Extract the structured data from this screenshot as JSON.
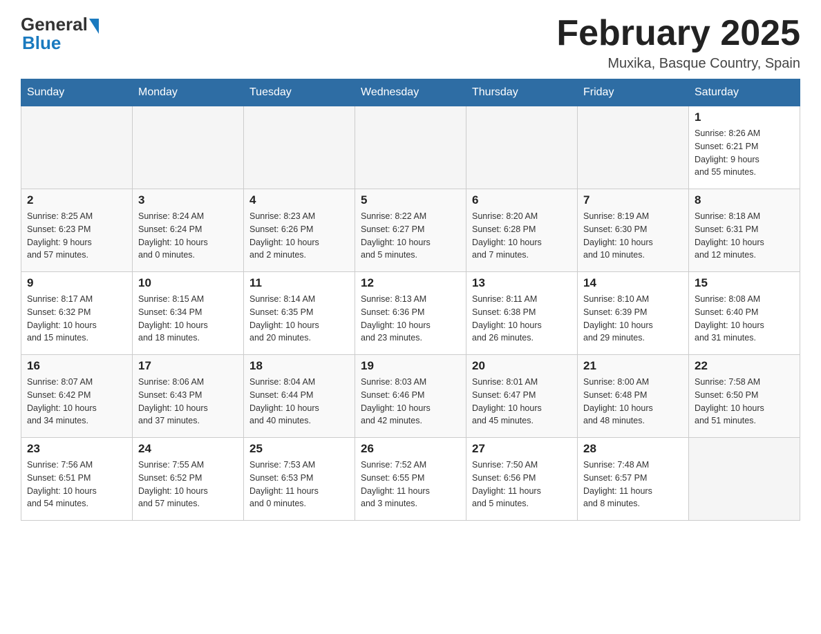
{
  "header": {
    "logo_general": "General",
    "logo_blue": "Blue",
    "month_title": "February 2025",
    "location": "Muxika, Basque Country, Spain"
  },
  "days_of_week": [
    "Sunday",
    "Monday",
    "Tuesday",
    "Wednesday",
    "Thursday",
    "Friday",
    "Saturday"
  ],
  "weeks": [
    {
      "days": [
        {
          "number": "",
          "info": ""
        },
        {
          "number": "",
          "info": ""
        },
        {
          "number": "",
          "info": ""
        },
        {
          "number": "",
          "info": ""
        },
        {
          "number": "",
          "info": ""
        },
        {
          "number": "",
          "info": ""
        },
        {
          "number": "1",
          "info": "Sunrise: 8:26 AM\nSunset: 6:21 PM\nDaylight: 9 hours\nand 55 minutes."
        }
      ]
    },
    {
      "days": [
        {
          "number": "2",
          "info": "Sunrise: 8:25 AM\nSunset: 6:23 PM\nDaylight: 9 hours\nand 57 minutes."
        },
        {
          "number": "3",
          "info": "Sunrise: 8:24 AM\nSunset: 6:24 PM\nDaylight: 10 hours\nand 0 minutes."
        },
        {
          "number": "4",
          "info": "Sunrise: 8:23 AM\nSunset: 6:26 PM\nDaylight: 10 hours\nand 2 minutes."
        },
        {
          "number": "5",
          "info": "Sunrise: 8:22 AM\nSunset: 6:27 PM\nDaylight: 10 hours\nand 5 minutes."
        },
        {
          "number": "6",
          "info": "Sunrise: 8:20 AM\nSunset: 6:28 PM\nDaylight: 10 hours\nand 7 minutes."
        },
        {
          "number": "7",
          "info": "Sunrise: 8:19 AM\nSunset: 6:30 PM\nDaylight: 10 hours\nand 10 minutes."
        },
        {
          "number": "8",
          "info": "Sunrise: 8:18 AM\nSunset: 6:31 PM\nDaylight: 10 hours\nand 12 minutes."
        }
      ]
    },
    {
      "days": [
        {
          "number": "9",
          "info": "Sunrise: 8:17 AM\nSunset: 6:32 PM\nDaylight: 10 hours\nand 15 minutes."
        },
        {
          "number": "10",
          "info": "Sunrise: 8:15 AM\nSunset: 6:34 PM\nDaylight: 10 hours\nand 18 minutes."
        },
        {
          "number": "11",
          "info": "Sunrise: 8:14 AM\nSunset: 6:35 PM\nDaylight: 10 hours\nand 20 minutes."
        },
        {
          "number": "12",
          "info": "Sunrise: 8:13 AM\nSunset: 6:36 PM\nDaylight: 10 hours\nand 23 minutes."
        },
        {
          "number": "13",
          "info": "Sunrise: 8:11 AM\nSunset: 6:38 PM\nDaylight: 10 hours\nand 26 minutes."
        },
        {
          "number": "14",
          "info": "Sunrise: 8:10 AM\nSunset: 6:39 PM\nDaylight: 10 hours\nand 29 minutes."
        },
        {
          "number": "15",
          "info": "Sunrise: 8:08 AM\nSunset: 6:40 PM\nDaylight: 10 hours\nand 31 minutes."
        }
      ]
    },
    {
      "days": [
        {
          "number": "16",
          "info": "Sunrise: 8:07 AM\nSunset: 6:42 PM\nDaylight: 10 hours\nand 34 minutes."
        },
        {
          "number": "17",
          "info": "Sunrise: 8:06 AM\nSunset: 6:43 PM\nDaylight: 10 hours\nand 37 minutes."
        },
        {
          "number": "18",
          "info": "Sunrise: 8:04 AM\nSunset: 6:44 PM\nDaylight: 10 hours\nand 40 minutes."
        },
        {
          "number": "19",
          "info": "Sunrise: 8:03 AM\nSunset: 6:46 PM\nDaylight: 10 hours\nand 42 minutes."
        },
        {
          "number": "20",
          "info": "Sunrise: 8:01 AM\nSunset: 6:47 PM\nDaylight: 10 hours\nand 45 minutes."
        },
        {
          "number": "21",
          "info": "Sunrise: 8:00 AM\nSunset: 6:48 PM\nDaylight: 10 hours\nand 48 minutes."
        },
        {
          "number": "22",
          "info": "Sunrise: 7:58 AM\nSunset: 6:50 PM\nDaylight: 10 hours\nand 51 minutes."
        }
      ]
    },
    {
      "days": [
        {
          "number": "23",
          "info": "Sunrise: 7:56 AM\nSunset: 6:51 PM\nDaylight: 10 hours\nand 54 minutes."
        },
        {
          "number": "24",
          "info": "Sunrise: 7:55 AM\nSunset: 6:52 PM\nDaylight: 10 hours\nand 57 minutes."
        },
        {
          "number": "25",
          "info": "Sunrise: 7:53 AM\nSunset: 6:53 PM\nDaylight: 11 hours\nand 0 minutes."
        },
        {
          "number": "26",
          "info": "Sunrise: 7:52 AM\nSunset: 6:55 PM\nDaylight: 11 hours\nand 3 minutes."
        },
        {
          "number": "27",
          "info": "Sunrise: 7:50 AM\nSunset: 6:56 PM\nDaylight: 11 hours\nand 5 minutes."
        },
        {
          "number": "28",
          "info": "Sunrise: 7:48 AM\nSunset: 6:57 PM\nDaylight: 11 hours\nand 8 minutes."
        },
        {
          "number": "",
          "info": ""
        }
      ]
    }
  ]
}
